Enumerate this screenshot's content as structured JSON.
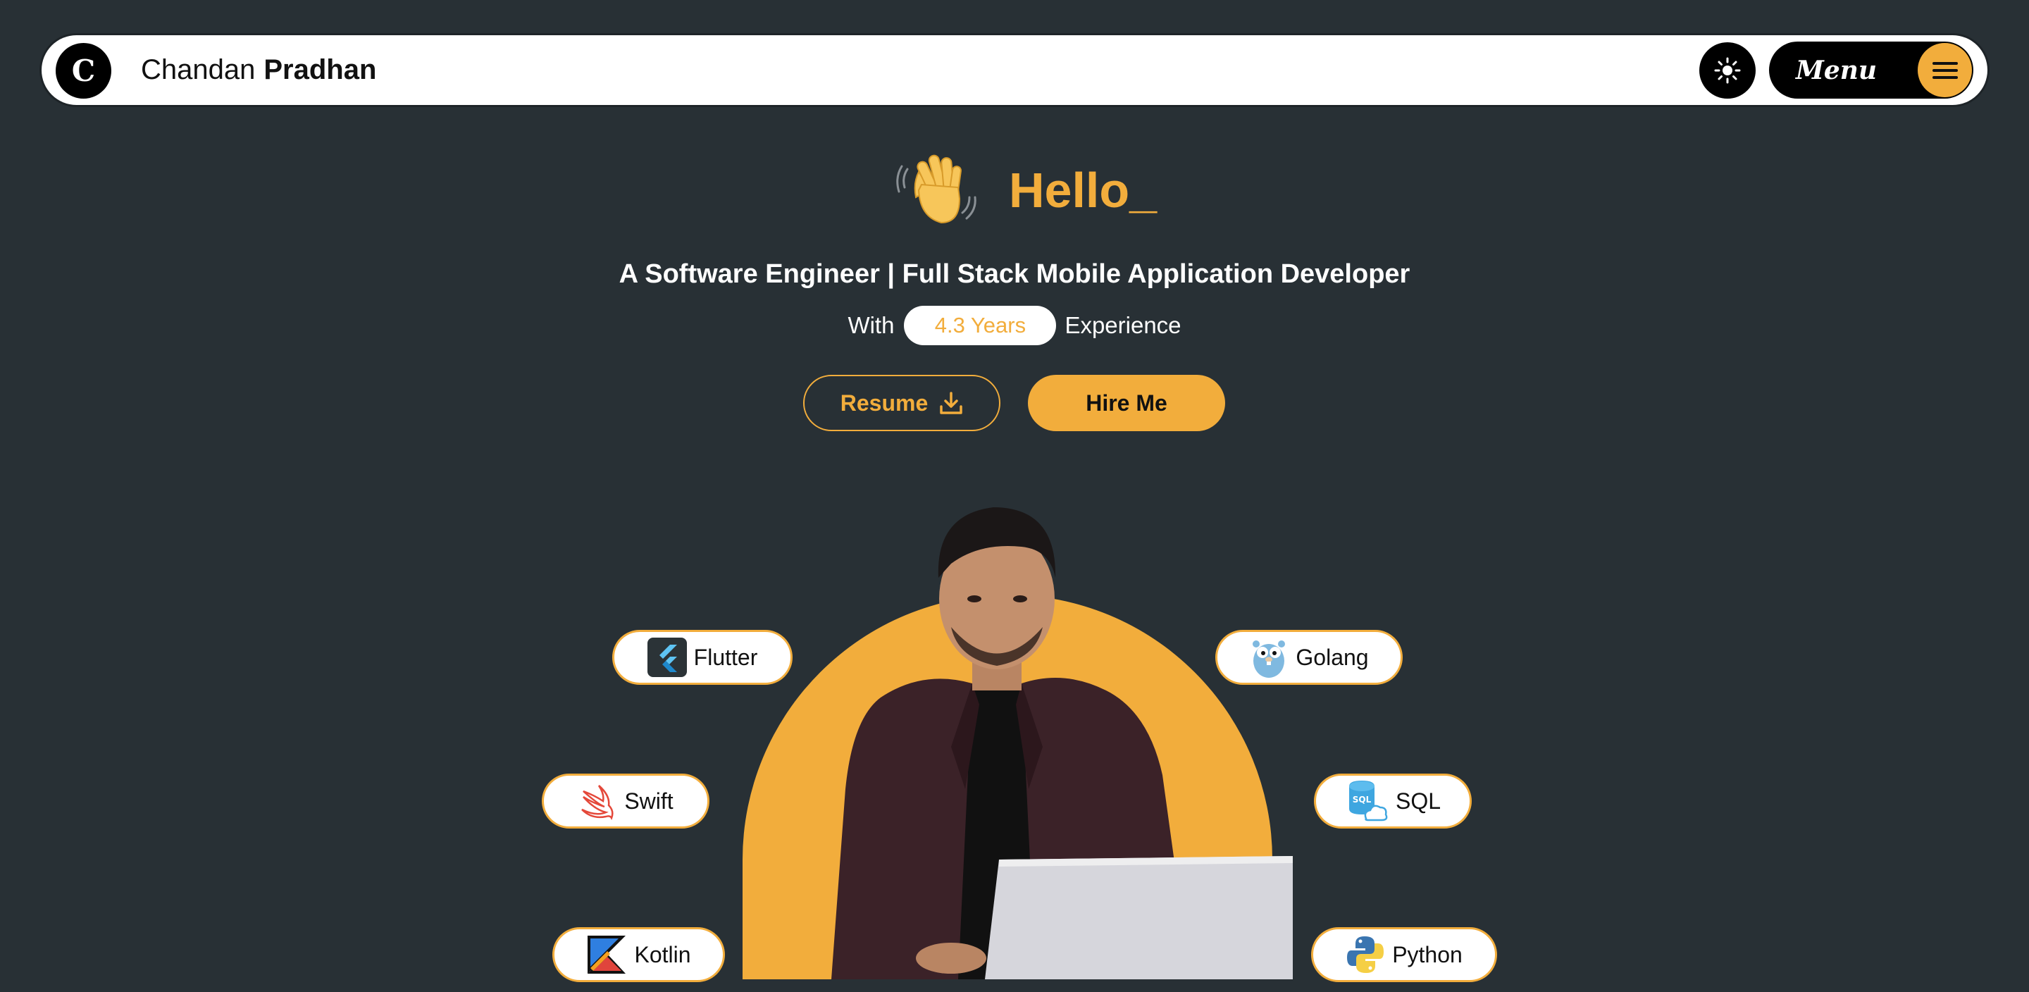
{
  "nav": {
    "logo_letter": "C",
    "brand_first": "Chandan",
    "brand_last": "Pradhan",
    "theme_icon": "sun-icon",
    "menu_label": "Menu",
    "menu_icon": "hamburger-icon"
  },
  "hero": {
    "greeting_icon": "waving-hand-icon",
    "greeting": "Hello_",
    "tagline": "A Software Engineer | Full Stack Mobile Application Developer",
    "experience_prefix": "With",
    "experience_years": "4.3 Years",
    "experience_suffix": "Experience",
    "resume_label": "Resume",
    "resume_icon": "download-icon",
    "hire_label": "Hire Me"
  },
  "skills": [
    {
      "label": "Flutter",
      "icon": "flutter-icon"
    },
    {
      "label": "Swift",
      "icon": "swift-icon"
    },
    {
      "label": "Kotlin",
      "icon": "kotlin-icon"
    },
    {
      "label": "Golang",
      "icon": "gopher-icon"
    },
    {
      "label": "SQL",
      "icon": "sql-database-icon"
    },
    {
      "label": "Python",
      "icon": "python-icon"
    }
  ],
  "colors": {
    "background": "#283035",
    "accent": "#f2ad3c",
    "navbar": "#ffffff",
    "text_light": "#ffffff",
    "text_dark": "#111111"
  }
}
